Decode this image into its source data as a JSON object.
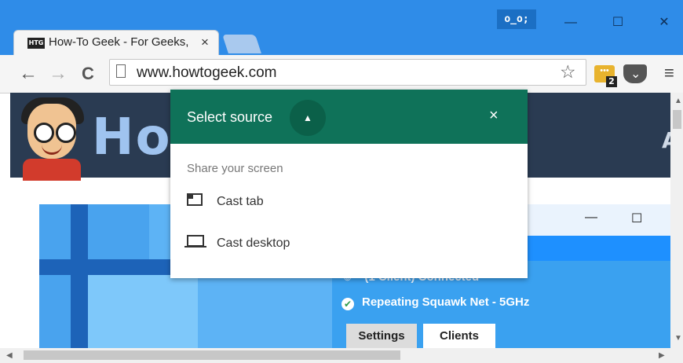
{
  "window": {
    "profile_label": "o_o;",
    "minimize": "—",
    "maximize": "☐",
    "close": "✕"
  },
  "tab": {
    "favicon_text": "HTG",
    "title": "How-To Geek - For Geeks, ",
    "close": "×"
  },
  "toolbar": {
    "back": "←",
    "forward": "→",
    "reload": "C",
    "url": "www.howtogeek.com",
    "star": "☆",
    "ext_badge": "2",
    "menu": "≡"
  },
  "page": {
    "banner_logo": "How",
    "banner_tail": "A",
    "app": {
      "status": "(1 Client) Connected",
      "network": "Repeating Squawk Net - 5GHz",
      "tabs": [
        "Settings",
        "Clients"
      ]
    }
  },
  "cast_dialog": {
    "title": "Select source",
    "close": "×",
    "subtitle": "Share your screen",
    "items": [
      {
        "label": "Cast tab",
        "icon": "tab-icon"
      },
      {
        "label": "Cast desktop",
        "icon": "laptop-icon"
      }
    ]
  }
}
